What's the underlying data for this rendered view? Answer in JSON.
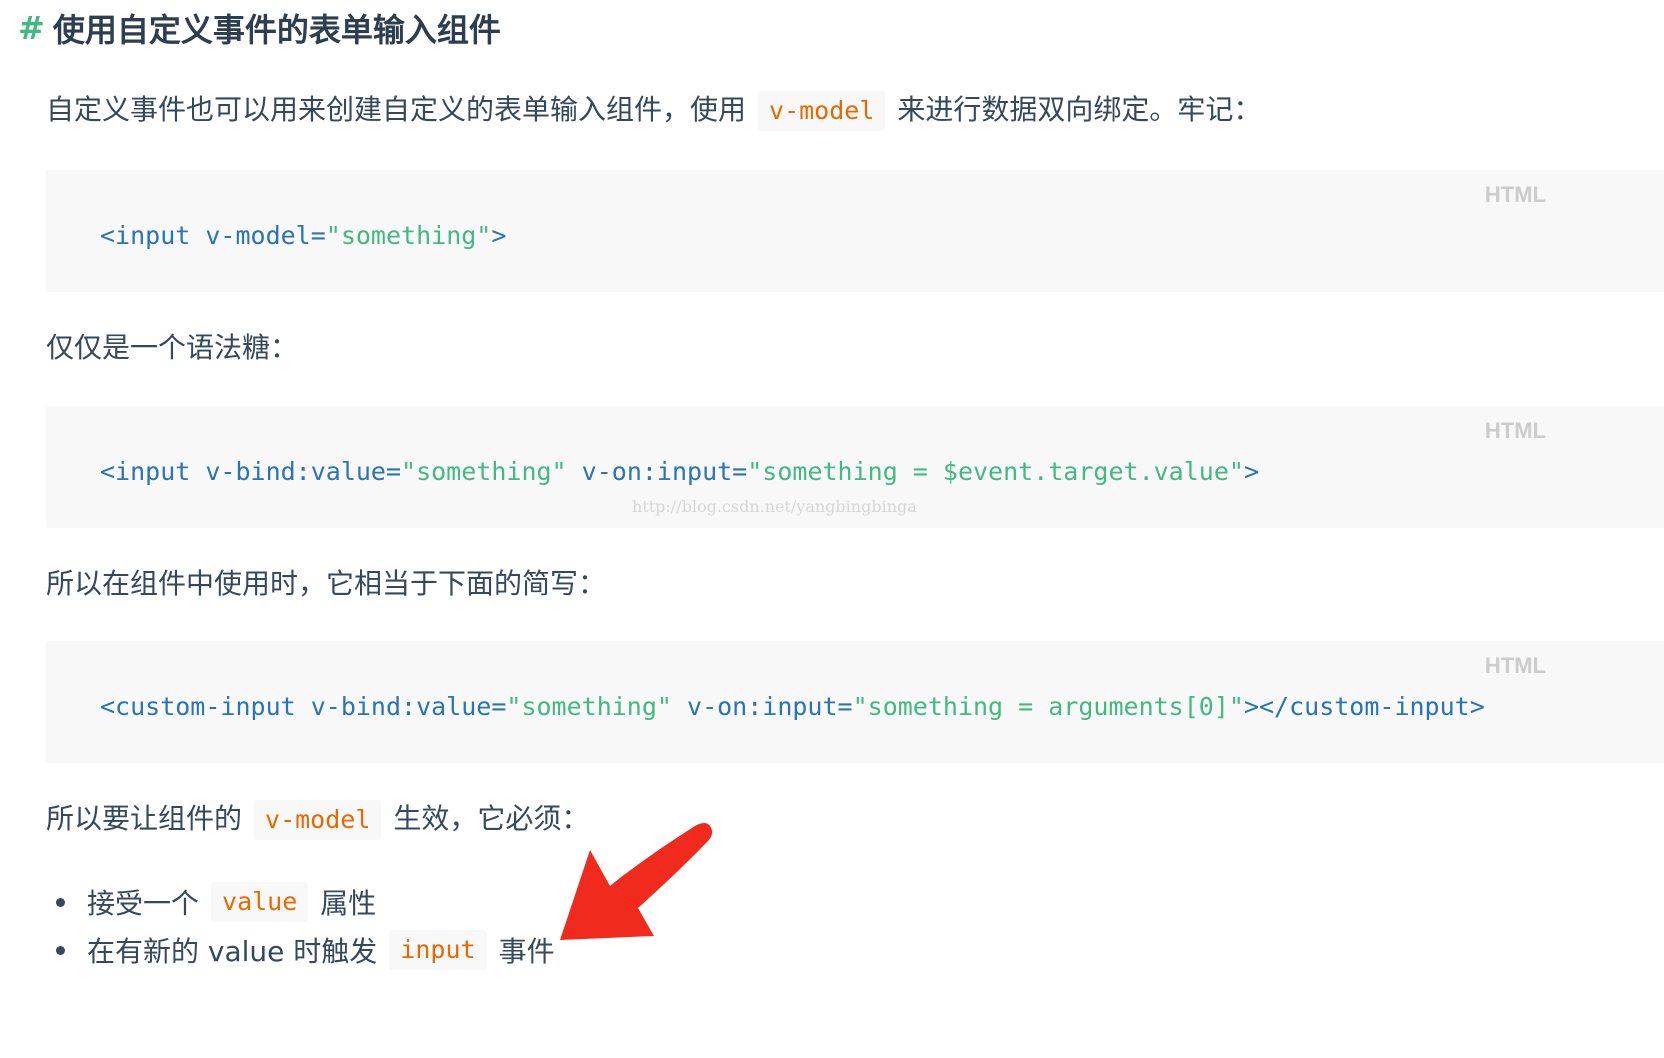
{
  "heading": {
    "hash": "#",
    "title": "使用自定义事件的表单输入组件"
  },
  "intro": {
    "before": "自定义事件也可以用来创建自定义的表单输入组件，使用",
    "code": "v-model",
    "after": "来进行数据双向绑定。牢记："
  },
  "code_block_1": {
    "lang": "HTML",
    "p1": "<input v-model=",
    "s1": "\"something\"",
    "p2": ">"
  },
  "para_sugar": "仅仅是一个语法糖：",
  "code_block_2": {
    "lang": "HTML",
    "p1": "<input v-bind:value=",
    "s1": "\"something\"",
    "p2": " v-on:input=",
    "s2": "\"something = $event.target.value\"",
    "p3": ">"
  },
  "watermark": "http://blog.csdn.net/yangbingbinga",
  "para_shorthand": "所以在组件中使用时，它相当于下面的简写：",
  "code_block_3": {
    "lang": "HTML",
    "p1": "<custom-input v-bind:value=",
    "s1": "\"something\"",
    "p2": " v-on:input=",
    "s2": "\"something = arguments[0]\"",
    "p3": "></custom-input>"
  },
  "requirement": {
    "before": "所以要让组件的",
    "code": "v-model",
    "after": "生效，它必须："
  },
  "bullets": [
    {
      "before": "接受一个",
      "code": "value",
      "after": "属性"
    },
    {
      "before": "在有新的 value 时触发",
      "code": "input",
      "after": "事件"
    }
  ],
  "colors": {
    "accent": "#42b983",
    "tag": "#2973b7",
    "inline_code": "#e96900",
    "code_bg": "#f8f8f8",
    "arrow": "#f02b1d"
  },
  "icons": {
    "annotation": "red-arrow-icon"
  }
}
